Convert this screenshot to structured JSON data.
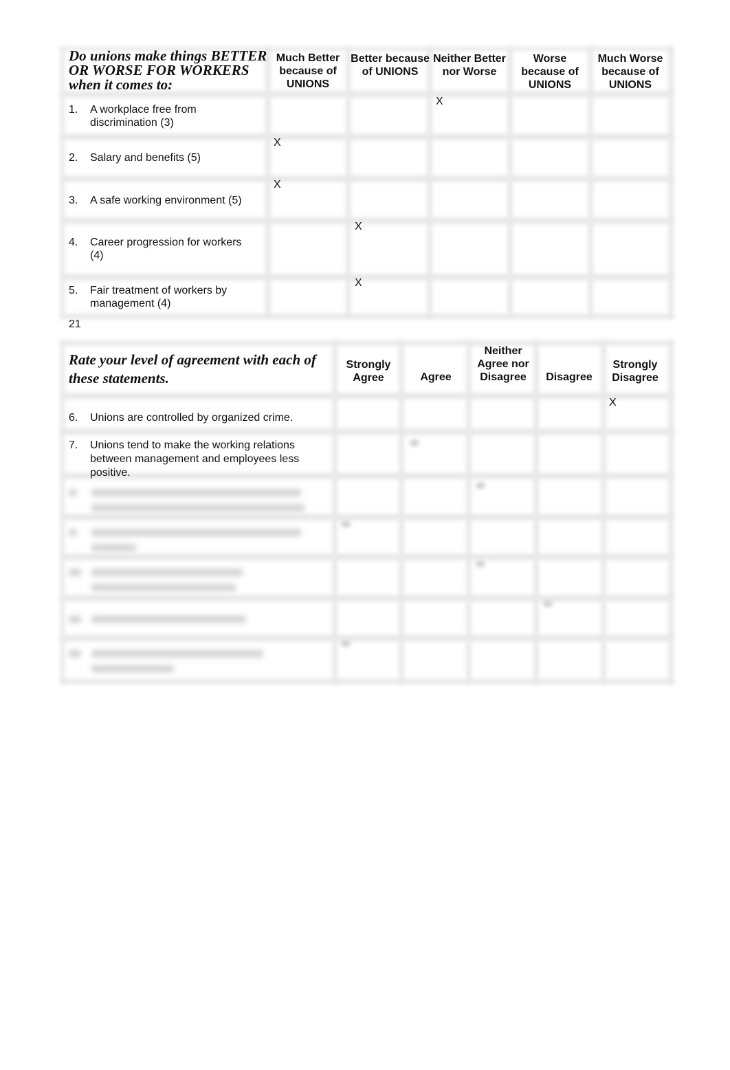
{
  "section1": {
    "title": "Do unions make things BETTER OR WORSE FOR WORKERS when it comes to:",
    "columns": [
      "Much Better because of UNIONS",
      "Better because of UNIONS",
      "Neither Better nor Worse",
      "Worse because of UNIONS",
      "Much Worse because of UNIONS"
    ],
    "items": [
      {
        "num": "1.",
        "text": "A workplace free from discrimination (3)",
        "selected_column": "Neither Better nor Worse",
        "mark": "X"
      },
      {
        "num": "2.",
        "text": "Salary and benefits (5)",
        "selected_column": "Much Better because of UNIONS",
        "mark": "X"
      },
      {
        "num": "3.",
        "text": "A safe working environment (5)",
        "selected_column": "Much Better because of UNIONS",
        "mark": "X"
      },
      {
        "num": "4.",
        "text": "Career progression for workers (4)",
        "selected_column": "Better because of UNIONS",
        "mark": "X"
      },
      {
        "num": "5.",
        "text": "Fair treatment of workers by management (4)",
        "selected_column": "Better because of UNIONS",
        "mark": "X"
      }
    ],
    "total": "21"
  },
  "section2": {
    "title": "Rate your level of agreement with each of these statements.",
    "columns": [
      "Strongly Agree",
      "Agree",
      "Neither Agree nor Disagree",
      "Disagree",
      "Strongly Disagree"
    ],
    "items": [
      {
        "num": "6.",
        "text": "Unions are controlled by organized crime.",
        "selected_column": "Strongly Disagree",
        "mark": "X"
      },
      {
        "num": "7.",
        "text": "Unions tend to make the working relations between management and employees less positive.",
        "selected_column": "Agree",
        "mark": "(blurred)"
      }
    ],
    "blurred_rows_note": "Rows 8–12 are obscured (blurred) in the screenshot"
  }
}
